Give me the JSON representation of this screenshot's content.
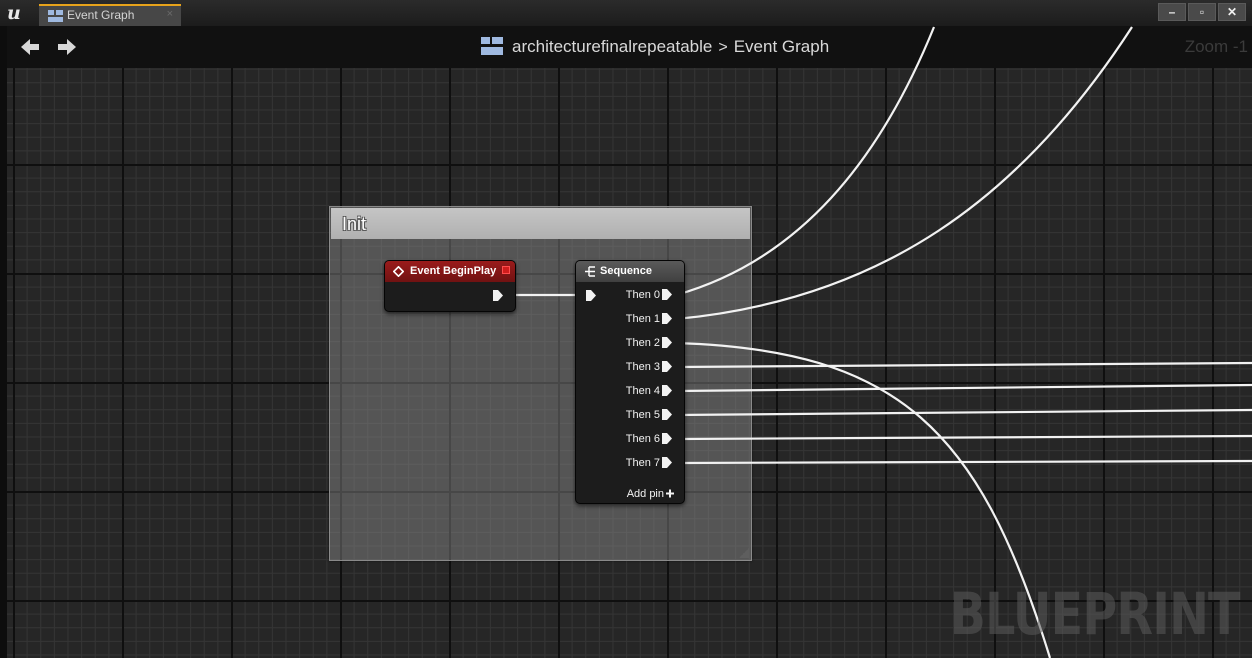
{
  "window": {
    "tab_label": "Event Graph",
    "tab_close": "×",
    "controls": [
      "–",
      "▫",
      "✕"
    ]
  },
  "navigation": {
    "breadcrumb": {
      "asset": "architecturefinalrepeatable",
      "separator": ">",
      "graph": "Event Graph"
    },
    "zoom_label": "Zoom -1"
  },
  "comment_box": {
    "title": "Init"
  },
  "nodes": {
    "event_begin_play": {
      "title": "Event BeginPlay",
      "header_color": "#8a1616"
    },
    "sequence": {
      "title": "Sequence",
      "outputs": [
        "Then 0",
        "Then 1",
        "Then 2",
        "Then 3",
        "Then 4",
        "Then 5",
        "Then 6",
        "Then 7"
      ],
      "add_pin_label": "Add pin"
    }
  },
  "watermark": "BLUEPRINT",
  "colors": {
    "tab_accent": "#e8a31b",
    "exec_wire": "#f2f2f2",
    "graph_background": "#262626"
  }
}
